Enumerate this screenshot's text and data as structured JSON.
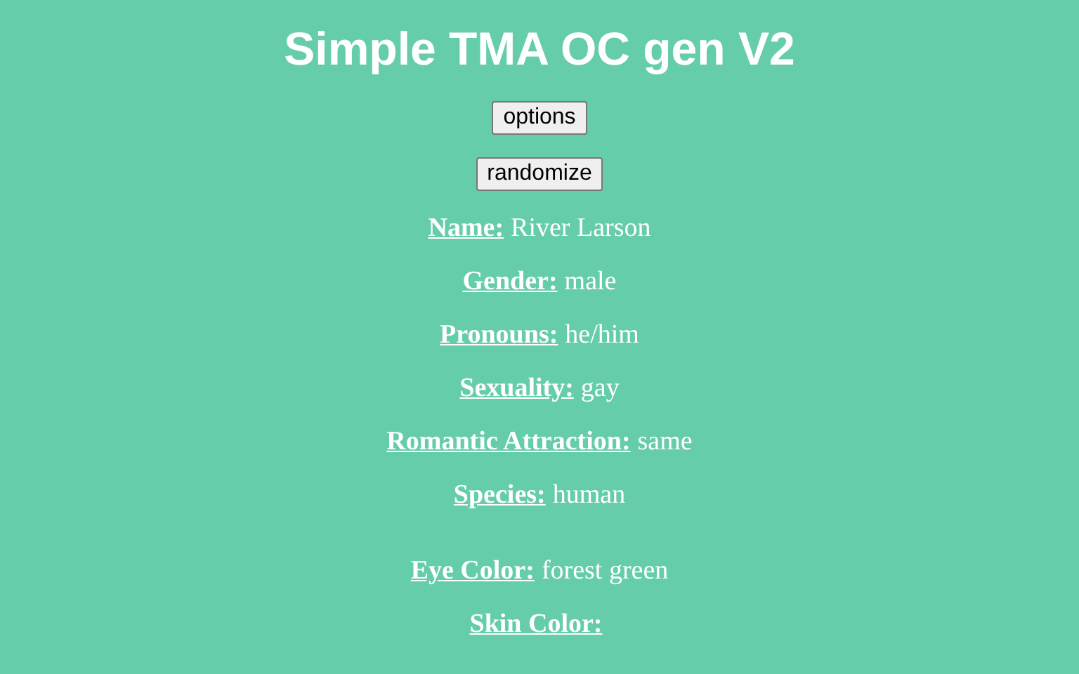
{
  "title": "Simple TMA OC gen V2",
  "buttons": [
    "options",
    "randomize"
  ],
  "groups": [
    [
      {
        "label": "Name:",
        "value": "River Larson"
      },
      {
        "label": "Gender:",
        "value": "male"
      },
      {
        "label": "Pronouns:",
        "value": "he/him"
      },
      {
        "label": "Sexuality:",
        "value": "gay"
      },
      {
        "label": "Romantic Attraction:",
        "value": "same"
      },
      {
        "label": "Species:",
        "value": "human"
      }
    ],
    [
      {
        "label": "Eye Color:",
        "value": "forest green"
      },
      {
        "label": "Skin Color:"
      }
    ]
  ]
}
